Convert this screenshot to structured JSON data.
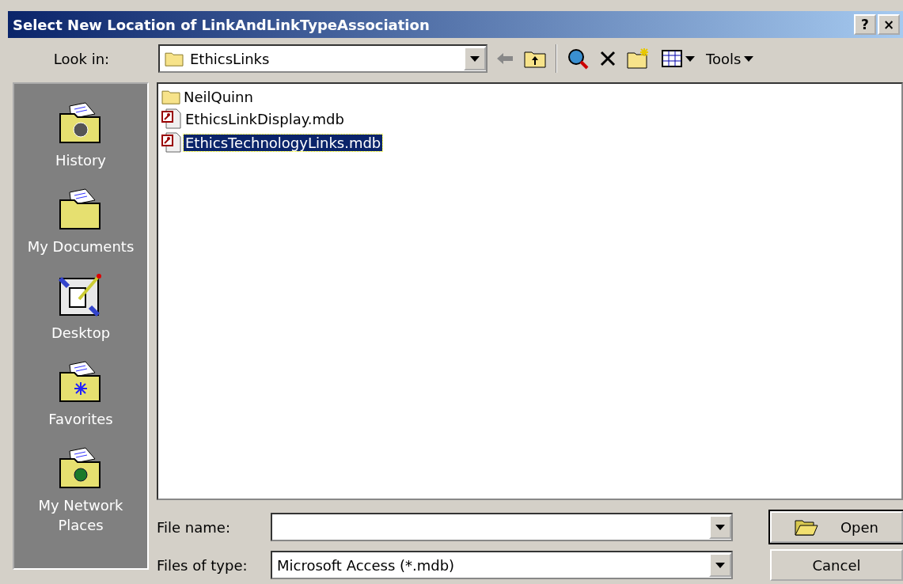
{
  "window": {
    "title": "Select New Location of LinkAndLinkTypeAssociation",
    "title_buttons": [
      "?",
      "×"
    ]
  },
  "look_in": {
    "label": "Look in:",
    "value": "EthicsLinks"
  },
  "toolbar": {
    "tools_label": "Tools"
  },
  "places": [
    {
      "label": "History",
      "kind": "history"
    },
    {
      "label": "My Documents",
      "kind": "documents"
    },
    {
      "label": "Desktop",
      "kind": "desktop"
    },
    {
      "label": "Favorites",
      "kind": "favorites"
    },
    {
      "label": "My Network Places",
      "kind": "network"
    }
  ],
  "files": [
    {
      "name": "NeilQuinn",
      "kind": "folder",
      "selected": false
    },
    {
      "name": "EthicsLinkDisplay.mdb",
      "kind": "mdb",
      "selected": false
    },
    {
      "name": "EthicsTechnologyLinks.mdb",
      "kind": "mdb",
      "selected": true
    }
  ],
  "file_name": {
    "label": "File name:"
  },
  "file_type": {
    "label": "Files of type:",
    "value": "Microsoft Access (*.mdb)"
  },
  "buttons": {
    "open": "Open",
    "cancel": "Cancel"
  }
}
